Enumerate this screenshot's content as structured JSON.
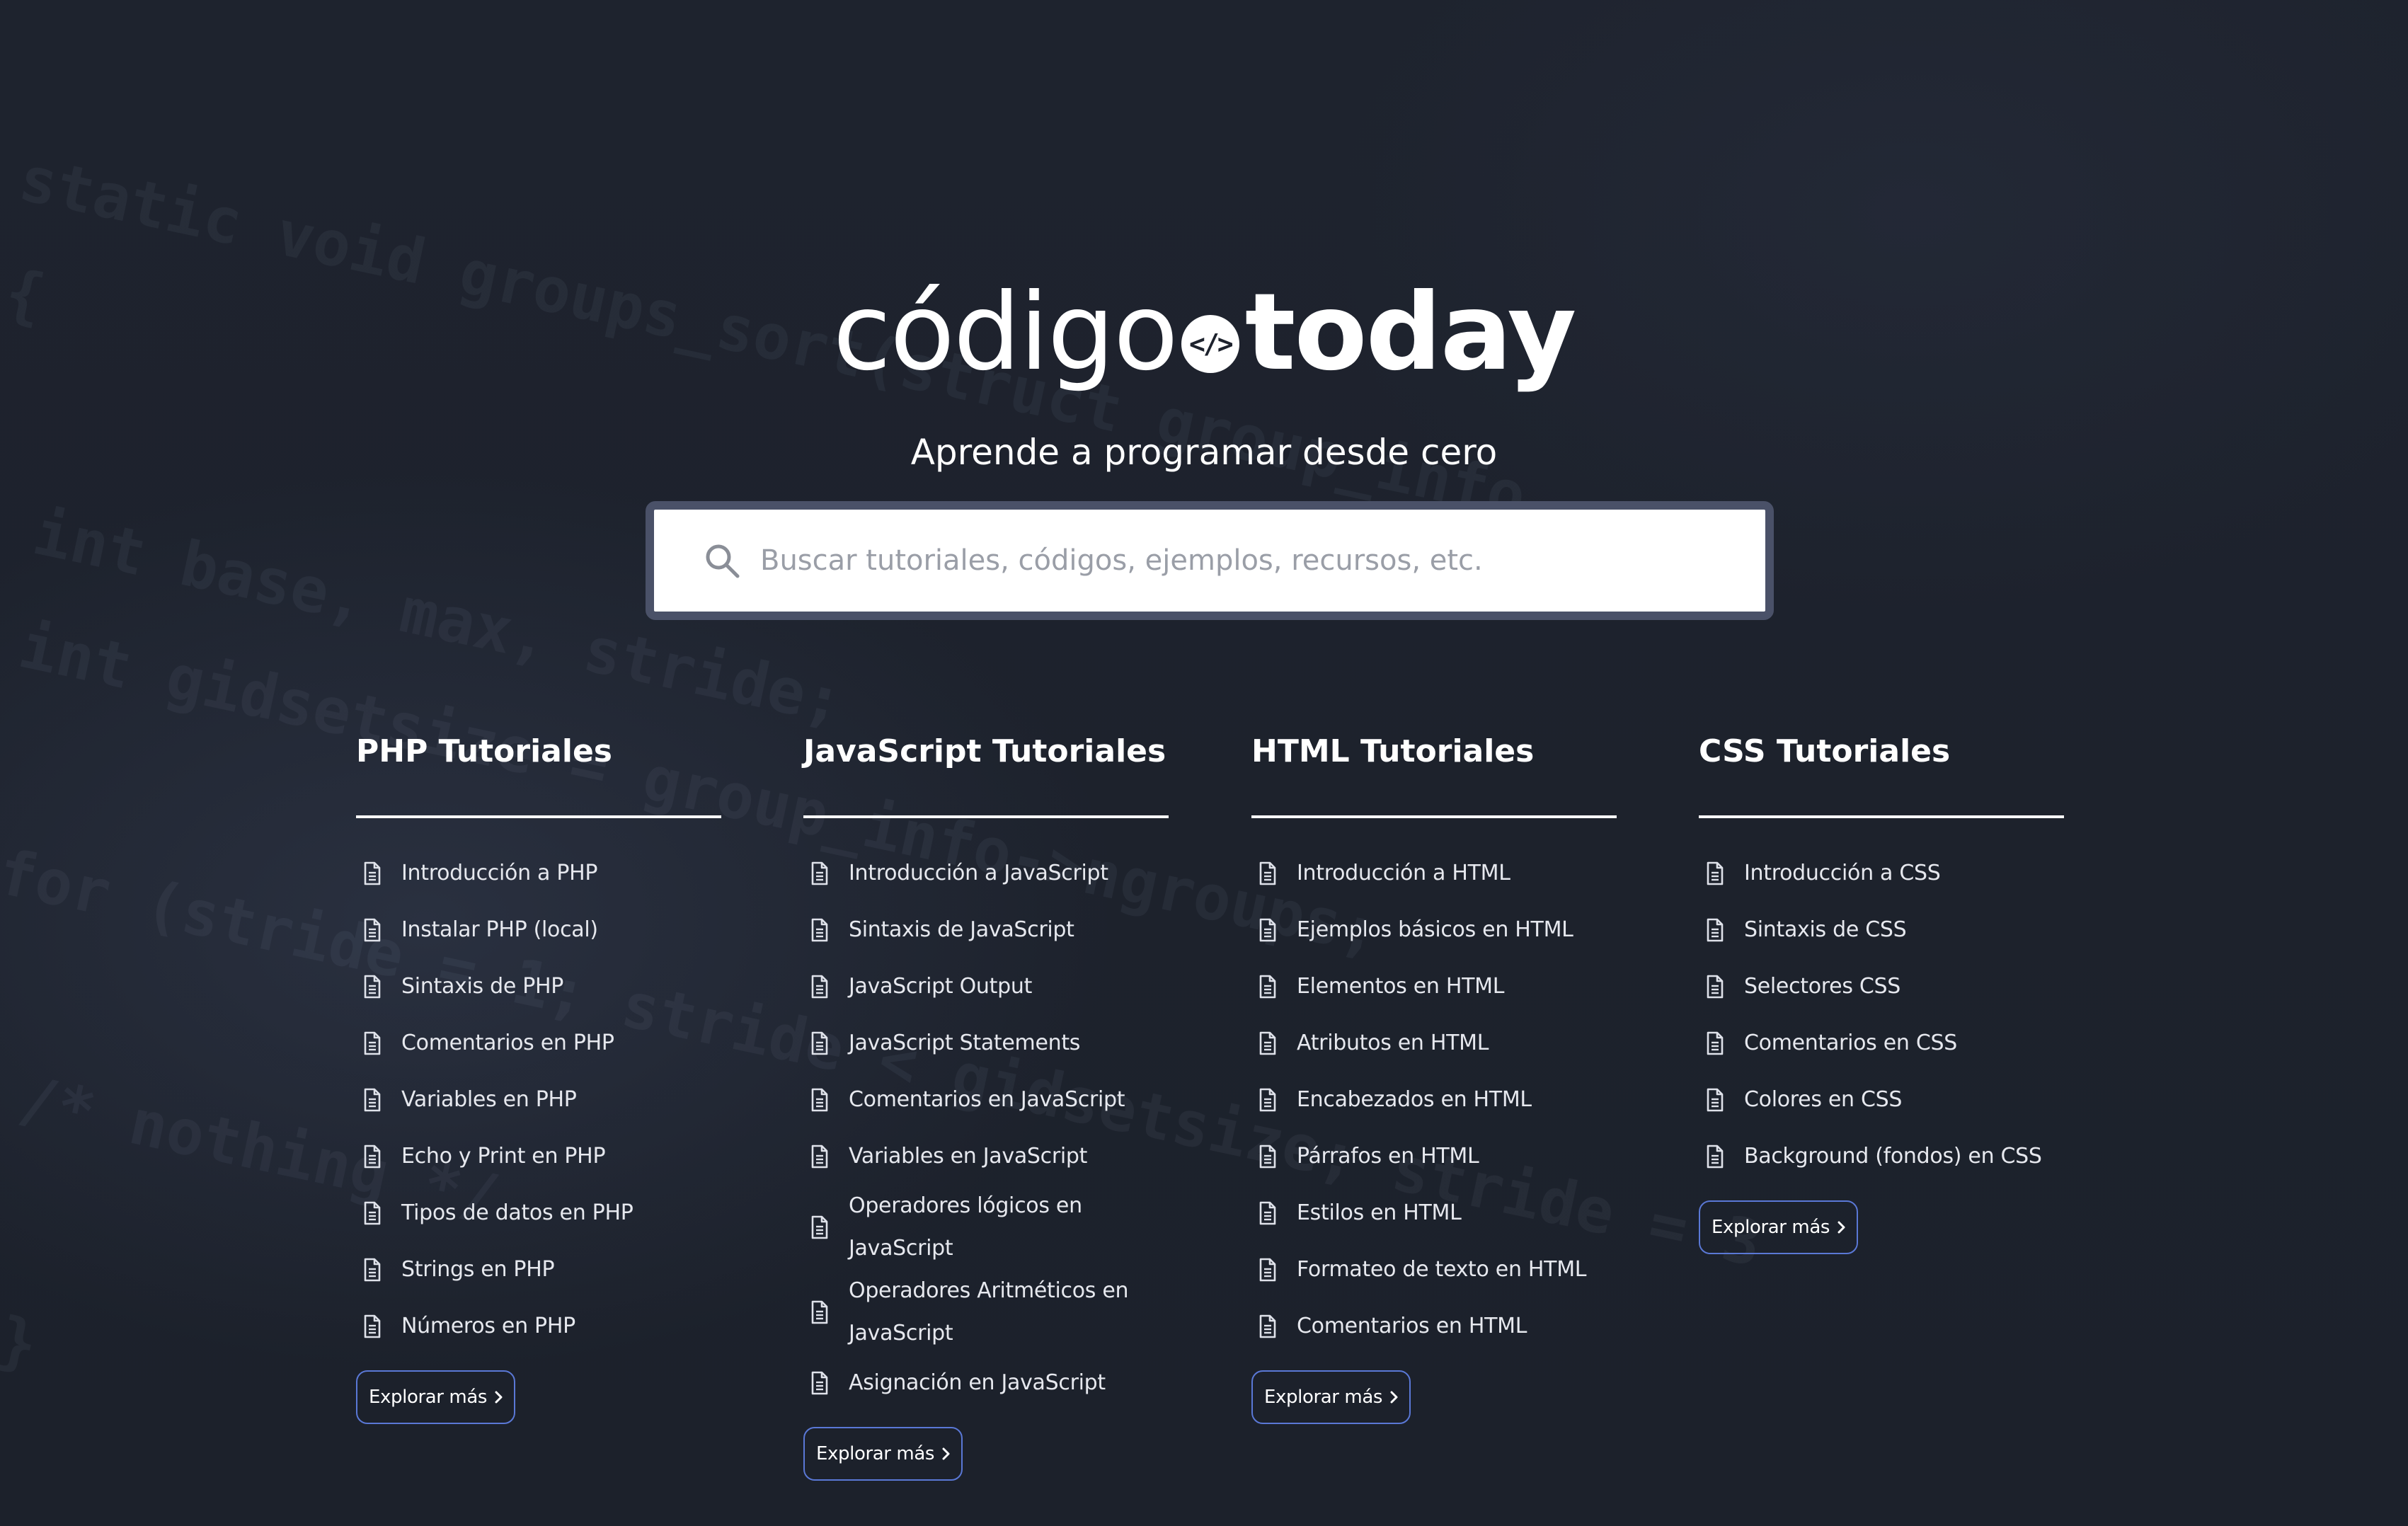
{
  "brand": {
    "name_light": "código",
    "name_bold": "today",
    "mark_symbol": "</>",
    "tagline": "Aprende a programar desde cero"
  },
  "search": {
    "placeholder": "Buscar tutoriales, códigos, ejemplos, recursos, etc.",
    "value": "",
    "icon": "search-icon"
  },
  "background_code": [
    "static void groups_sort(struct group_info",
    "{",
    "int base, max, stride;",
    "int gidsetsize = group_info->ngroups;",
    "for (stride = 1; stride < gidsetsize; stride = 3",
    "/* nothing */",
    "}"
  ],
  "columns": [
    {
      "title": "PHP Tutoriales",
      "items": [
        "Introducción a PHP",
        "Instalar PHP (local)",
        "Sintaxis de PHP",
        "Comentarios en PHP",
        "Variables en PHP",
        "Echo y Print en PHP",
        "Tipos de datos en PHP",
        "Strings en PHP",
        "Números en PHP"
      ],
      "button": "Explorar más"
    },
    {
      "title": "JavaScript Tutoriales",
      "items": [
        "Introducción a JavaScript",
        "Sintaxis de JavaScript",
        "JavaScript Output",
        "JavaScript Statements",
        "Comentarios en JavaScript",
        "Variables en JavaScript",
        "Operadores lógicos en JavaScript",
        "Operadores Aritméticos en JavaScript",
        "Asignación en JavaScript"
      ],
      "button": "Explorar más"
    },
    {
      "title": "HTML Tutoriales",
      "items": [
        "Introducción a HTML",
        "Ejemplos básicos en HTML",
        "Elementos en HTML",
        "Atributos en HTML",
        "Encabezados en HTML",
        "Párrafos en HTML",
        "Estilos en HTML",
        "Formateo de texto en HTML",
        "Comentarios en HTML"
      ],
      "button": "Explorar más"
    },
    {
      "title": "CSS Tutoriales",
      "items": [
        "Introducción a CSS",
        "Sintaxis de CSS",
        "Selectores CSS",
        "Comentarios en CSS",
        "Colores en CSS",
        "Background (fondos) en CSS"
      ],
      "button": "Explorar más"
    }
  ],
  "colors": {
    "background": "#1d222d",
    "search_border": "#4a5168",
    "button_border": "#5a78d6",
    "text": "#ffffff"
  }
}
